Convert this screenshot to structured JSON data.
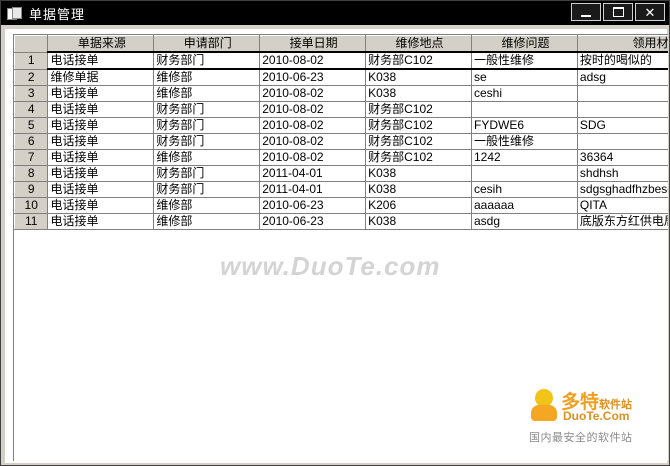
{
  "window": {
    "title": "单据管理"
  },
  "grid": {
    "columns": [
      "单据来源",
      "申请部门",
      "接单日期",
      "维修地点",
      "维修问题",
      "领用材料"
    ],
    "rows": [
      {
        "num": "1",
        "cells": [
          "电话接单",
          "财务部门",
          "2010-08-02",
          "财务部C102",
          "一般性维修",
          "按时的喝似的"
        ]
      },
      {
        "num": "2",
        "cells": [
          "维修单据",
          "维修部",
          "2010-06-23",
          "K038",
          "se",
          "adsg"
        ]
      },
      {
        "num": "3",
        "cells": [
          "电话接单",
          "维修部",
          "2010-08-02",
          "K038",
          "ceshi",
          ""
        ]
      },
      {
        "num": "4",
        "cells": [
          "电话接单",
          "财务部门",
          "2010-08-02",
          "财务部C102",
          "",
          ""
        ]
      },
      {
        "num": "5",
        "cells": [
          "电话接单",
          "财务部门",
          "2010-08-02",
          "财务部C102",
          "FYDWE6",
          "SDG"
        ]
      },
      {
        "num": "6",
        "cells": [
          "电话接单",
          "财务部门",
          "2010-08-02",
          "财务部C102",
          "一般性维修",
          ""
        ]
      },
      {
        "num": "7",
        "cells": [
          "电话接单",
          "维修部",
          "2010-08-02",
          "财务部C102",
          "1242",
          "36364"
        ]
      },
      {
        "num": "8",
        "cells": [
          "电话接单",
          "财务部门",
          "2011-04-01",
          "K038",
          "",
          "shdhsh"
        ]
      },
      {
        "num": "9",
        "cells": [
          "电话接单",
          "财务部门",
          "2011-04-01",
          "K038",
          "cesih",
          "sdgsghadfhzbesdhreshrserh"
        ]
      },
      {
        "num": "10",
        "cells": [
          "电话接单",
          "维修部",
          "2010-06-23",
          "K206",
          "aaaaaa",
          "QITA"
        ]
      },
      {
        "num": "11",
        "cells": [
          "电话接单",
          "维修部",
          "2010-06-23",
          "K038",
          "asdg",
          "底版东方红供电局看到"
        ]
      }
    ]
  },
  "watermark": {
    "text": "www.DuoTe.com"
  },
  "logo": {
    "name": "多特",
    "sub": "软件站",
    "url": "DuoTe.Com",
    "slogan": "国内最安全的软件站"
  }
}
